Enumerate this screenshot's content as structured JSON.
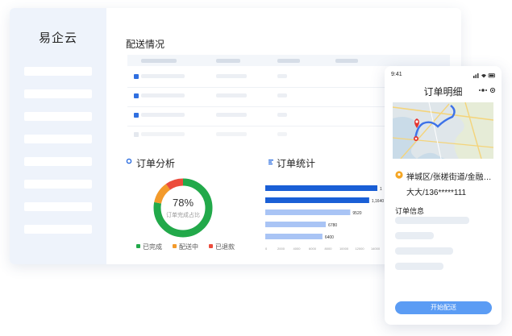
{
  "brand": "易企云",
  "delivery": {
    "title": "配送情况"
  },
  "order_analysis": {
    "title": "订单分析",
    "percent": "78%",
    "caption": "订单完成占比",
    "legend": [
      {
        "label": "已完成",
        "color": "#22a94a"
      },
      {
        "label": "配送中",
        "color": "#f39a2b"
      },
      {
        "label": "已退款",
        "color": "#ec4c3c"
      }
    ]
  },
  "order_stats": {
    "title": "订单统计"
  },
  "chart_data": {
    "type": "bar",
    "orientation": "horizontal",
    "values": [
      null,
      11640,
      9520,
      6780,
      6400
    ],
    "data_labels": [
      "1",
      "1,1640",
      "9520",
      "6780",
      "6400"
    ],
    "xticks": [
      "0",
      "2000",
      "4000",
      "6000",
      "8000",
      "10000",
      "12000",
      "14000"
    ],
    "xlim": [
      0,
      14000
    ],
    "colors": [
      "#1a5fd6",
      "#1a5fd6",
      "#a9c4f5",
      "#a9c4f5",
      "#a9c4f5"
    ]
  },
  "donut": {
    "completed": 0.78,
    "delivering": 0.12,
    "refunded": 0.1
  },
  "phone": {
    "time": "9:41",
    "title": "订单明细",
    "address": "禅城区/张槎街道/金融…",
    "contact": "大大/136*****111",
    "info_title": "订单信息",
    "start_button": "开始配送"
  },
  "colors": {
    "accent": "#1a5fd6",
    "sidebar": "#eef3fb",
    "button": "#5b9cf4"
  }
}
